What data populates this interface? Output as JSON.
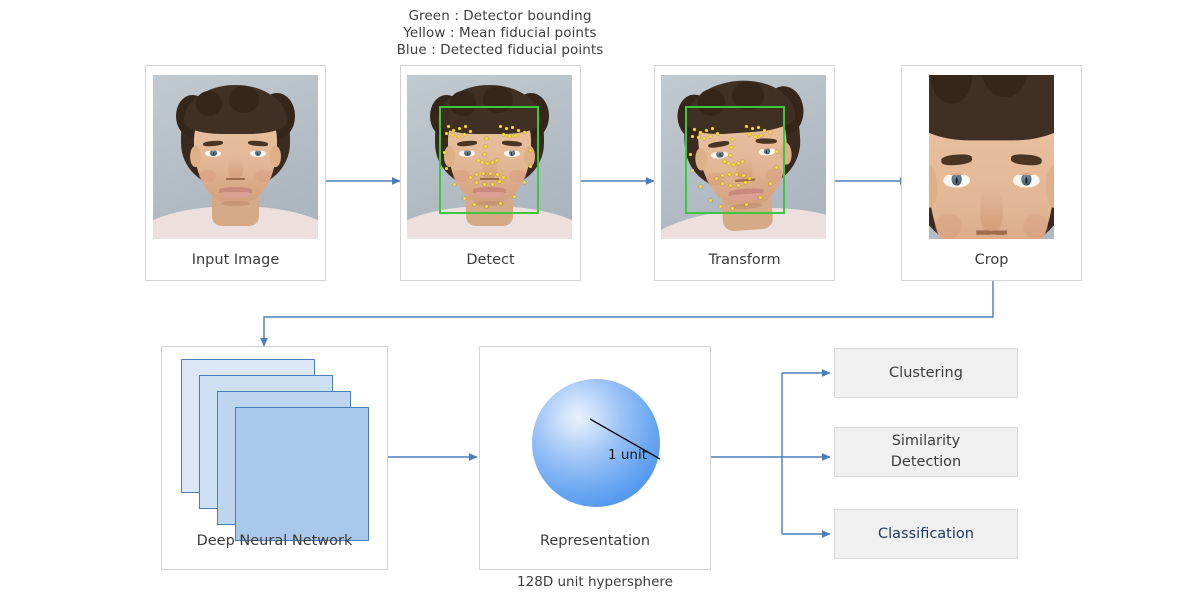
{
  "diagram": {
    "title": "Face recognition pipeline",
    "legend": {
      "lines": [
        "Green : Detector bounding",
        "Yellow : Mean fiducial points",
        "Blue :  Detected fiducial points"
      ],
      "colors": {
        "green": "#3ec73e",
        "yellow": "#ffe21f",
        "blue": "#4a7ebb"
      }
    },
    "stages": [
      {
        "id": "input-image",
        "label": "Input Image",
        "has_detector_box": false,
        "has_fiducials": false
      },
      {
        "id": "detect",
        "label": "Detect",
        "has_detector_box": true,
        "has_fiducials": true
      },
      {
        "id": "transform",
        "label": "Transform",
        "has_detector_box": true,
        "has_fiducials": true
      },
      {
        "id": "crop",
        "label": "Crop",
        "has_detector_box": false,
        "has_fiducials": false
      }
    ],
    "neural_network": {
      "label": "Deep Neural Network",
      "layer_count": 4,
      "layer_colors": [
        "#dbe7f6",
        "#cddff3",
        "#bed5f0",
        "#a9c8ea"
      ],
      "layer_border": "#4a7ebb"
    },
    "representation": {
      "label": "Representation",
      "radius_label": "1 unit",
      "caption": "128D unit hypersphere",
      "sphere_color": "#4d93ee"
    },
    "outputs": [
      {
        "id": "clustering",
        "label": "Clustering",
        "color": "#3b3b3b"
      },
      {
        "id": "similarity-detection",
        "label": "Similarity\nDetection",
        "color": "#3b3b3b"
      },
      {
        "id": "classification",
        "label": "Classification",
        "color": "#1f3864"
      }
    ],
    "connector_color": "#4a7ebb"
  }
}
